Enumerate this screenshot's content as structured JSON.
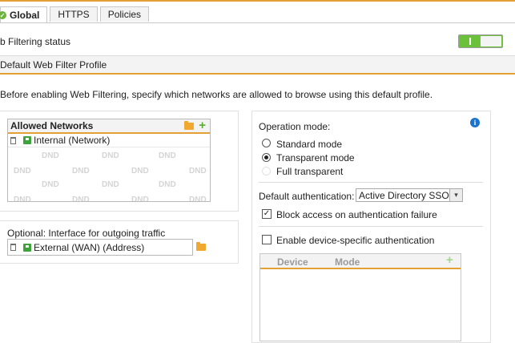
{
  "tabs": [
    {
      "label": "Global",
      "active": true
    },
    {
      "label": "HTTPS",
      "active": false
    },
    {
      "label": "Policies",
      "active": false
    }
  ],
  "status": {
    "label": "b Filtering status",
    "enabled": true
  },
  "section": {
    "title": "Default Web Filter Profile"
  },
  "intro": "Before enabling Web Filtering, specify which networks are allowed to browse using this default profile.",
  "allowed_networks": {
    "title": "Allowed Networks",
    "items": [
      "Internal (Network)"
    ],
    "placeholder": "DND"
  },
  "outgoing": {
    "label": "Optional: Interface for outgoing traffic",
    "value": "External (WAN) (Address)"
  },
  "operation_mode": {
    "label": "Operation mode:",
    "options": [
      {
        "label": "Standard mode",
        "selected": false,
        "disabled": false
      },
      {
        "label": "Transparent mode",
        "selected": true,
        "disabled": false
      },
      {
        "label": "Full transparent",
        "selected": false,
        "disabled": true
      }
    ]
  },
  "default_auth": {
    "label": "Default authentication:",
    "value": "Active Directory SSO"
  },
  "block_access": {
    "label": "Block access on authentication failure",
    "checked": true
  },
  "device_auth": {
    "label": "Enable device-specific authentication",
    "checked": false
  },
  "device_table": {
    "columns": [
      "Device",
      "Mode"
    ]
  },
  "colors": {
    "accent": "#e3a035",
    "toggle_on": "#6cc13a",
    "add": "#5aac2d",
    "info": "#1d73c9"
  }
}
